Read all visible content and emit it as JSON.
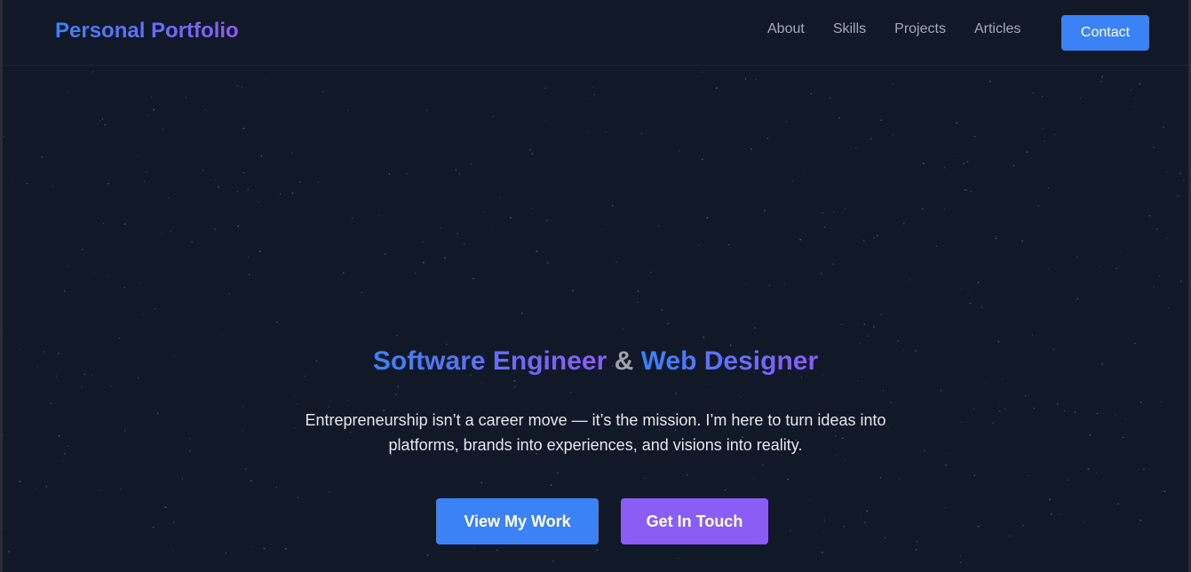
{
  "brand": {
    "name": "Personal Portfolio"
  },
  "nav": {
    "links": [
      "About",
      "Skills",
      "Projects",
      "Articles"
    ],
    "contact_label": "Contact"
  },
  "hero": {
    "headline_part1": "Software Engineer",
    "headline_amp": "&",
    "headline_part2": "Web Designer",
    "tagline": "Entrepreneurship isn’t a career move — it’s the mission. I’m here to turn ideas into platforms, brands into experiences, and visions into reality.",
    "primary_cta": "View My Work",
    "secondary_cta": "Get In Touch"
  },
  "colors": {
    "background": "#111827",
    "accent_blue": "#3b82f6",
    "accent_purple": "#8b5cf6",
    "nav_text": "#a3a9b6"
  }
}
